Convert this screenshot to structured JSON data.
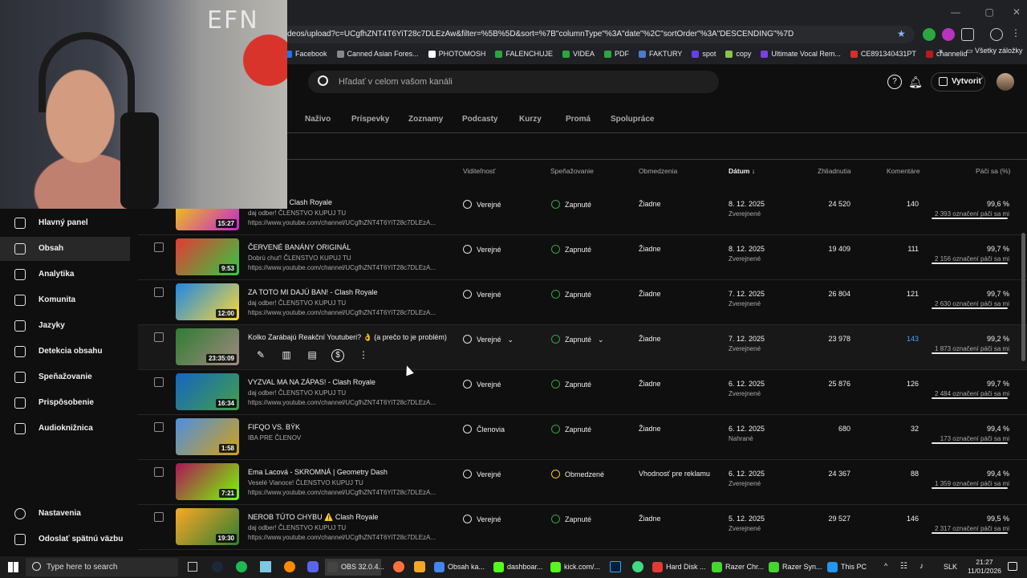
{
  "browser": {
    "url": "deos/upload?c=UCgfhZNT4T6YiT28c7DLEzAw&filter=%5B%5D&sort=%7B\"columnType\"%3A\"date\"%2C\"sortOrder\"%3A\"DESCENDING\"%7D",
    "bookmarks": [
      {
        "label": "Facebook",
        "color": "#1877f2"
      },
      {
        "label": "Canned Asian Fores...",
        "color": "#888"
      },
      {
        "label": "PHOTOMOSH",
        "color": "#fff"
      },
      {
        "label": "FALENCHUJE",
        "color": "#2ba640"
      },
      {
        "label": "VIDEA",
        "color": "#2ba640"
      },
      {
        "label": "PDF",
        "color": "#2ba640"
      },
      {
        "label": "FAKTURY",
        "color": "#4a7bd0"
      },
      {
        "label": "spot",
        "color": "#6a3de8"
      },
      {
        "label": "copy",
        "color": "#8bc34a"
      },
      {
        "label": "Ultimate Vocal Rem...",
        "color": "#7b3fe4"
      },
      {
        "label": "CE891340431PT",
        "color": "#d32f2f"
      },
      {
        "label": "channelid",
        "color": "#b71c1c"
      }
    ],
    "all_bookmarks": "Všetky záložky"
  },
  "header": {
    "search_placeholder": "Hľadať v celom vašom kanáli",
    "create_label": "Vytvoriť"
  },
  "tabs": [
    "Naživo",
    "Príspevky",
    "Zoznamy",
    "Podcasty",
    "Kurzy",
    "Promá",
    "Spolupráce"
  ],
  "columns": {
    "visibility": "Viditeľnosť",
    "monetization": "Speňažovanie",
    "restrictions": "Obmedzenia",
    "date": "Dátum",
    "views": "Zhliadnutia",
    "comments": "Komentáre",
    "likes": "Páči sa (%)"
  },
  "sidebar": [
    {
      "label": "Hlavný panel",
      "active": false
    },
    {
      "label": "Obsah",
      "active": true
    },
    {
      "label": "Analytika",
      "active": false
    },
    {
      "label": "Komunita",
      "active": false
    },
    {
      "label": "Jazyky",
      "active": false
    },
    {
      "label": "Detekcia obsahu",
      "active": false
    },
    {
      "label": "Speňažovanie",
      "active": false
    },
    {
      "label": "Prispôsobenie",
      "active": false
    },
    {
      "label": "Audioknižnica",
      "active": false
    }
  ],
  "sidebar_bottom": {
    "settings": "Nastavenia",
    "feedback": "Odoslať spätnú väzbu"
  },
  "videos": [
    {
      "title": "...KORD?? - Clash Royale",
      "desc": "daj odber! ČLENSTVO KUPUJ TU",
      "url": "https://www.youtube.com/channel/UCgfhZNT4T6YiT28c7DLEzA...",
      "duration": "15:27",
      "visibility": "Verejné",
      "monetization": "Zapnuté",
      "restrictions": "Žiadne",
      "date": "8. 12. 2025",
      "status": "Zverejnené",
      "views": "24 520",
      "comments": "140",
      "likes_pct": "99,6 %",
      "likes": "2 393 označení páči sa mi",
      "thumb": "linear-gradient(135deg,#f6d400,#c026d3)"
    },
    {
      "title": "ČERVENÉ BANÁNY ORIGINÁL",
      "desc": "Dobrú chuť! ČLENSTVO KUPUJ TU",
      "url": "https://www.youtube.com/channel/UCgfhZNT4T6YiT28c7DLEzA...",
      "duration": "9:53",
      "visibility": "Verejné",
      "monetization": "Zapnuté",
      "restrictions": "Žiadne",
      "date": "8. 12. 2025",
      "status": "Zverejnené",
      "views": "19 409",
      "comments": "111",
      "likes_pct": "99,7 %",
      "likes": "2 156 označení páči sa mi",
      "thumb": "linear-gradient(135deg,#e53935,#2ecc40)"
    },
    {
      "title": "ZA TOTO MI DAJÚ BAN! - Clash Royale",
      "desc": "daj odber! ČLENSTVO KUPUJ TU",
      "url": "https://www.youtube.com/channel/UCgfhZNT4T6YiT28c7DLEzA...",
      "duration": "12:00",
      "visibility": "Verejné",
      "monetization": "Zapnuté",
      "restrictions": "Žiadne",
      "date": "7. 12. 2025",
      "status": "Zverejnené",
      "views": "26 804",
      "comments": "121",
      "likes_pct": "99,7 %",
      "likes": "2 630 označení páči sa mi",
      "thumb": "linear-gradient(135deg,#1e88e5,#fdd835)"
    },
    {
      "title": "Kolko Zarábajú Reakční Youtuberi? 👌 (a prečo to je problém)",
      "desc": "",
      "url": "",
      "duration": "23:35:09",
      "visibility": "Verejné",
      "monetization": "Zapnuté",
      "restrictions": "Žiadne",
      "date": "7. 12. 2025",
      "status": "Zverejnené",
      "views": "23 978",
      "comments": "143",
      "likes_pct": "99,2 %",
      "likes": "1 873 označení páči sa mi",
      "thumb": "linear-gradient(135deg,#2e7d32,#a1887f)",
      "hover": true
    },
    {
      "title": "VYZVAL MA NA ZÁPAS! - Clash Royale",
      "desc": "daj odber! ČLENSTVO KUPUJ TU",
      "url": "https://www.youtube.com/channel/UCgfhZNT4T6YiT28c7DLEzA...",
      "duration": "16:34",
      "visibility": "Verejné",
      "monetization": "Zapnuté",
      "restrictions": "Žiadne",
      "date": "6. 12. 2025",
      "status": "Zverejnené",
      "views": "25 876",
      "comments": "126",
      "likes_pct": "99,7 %",
      "likes": "2 484 označení páči sa mi",
      "thumb": "linear-gradient(135deg,#1565c0,#43a047)"
    },
    {
      "title": "FIFQO VS. BÝK",
      "desc": "IBA PRE ČLENOV",
      "url": "",
      "duration": "1:58",
      "visibility": "Členovia",
      "monetization": "Zapnuté",
      "restrictions": "Žiadne",
      "date": "6. 12. 2025",
      "status": "Nahrané",
      "views": "680",
      "comments": "32",
      "likes_pct": "99,4 %",
      "likes": "173 označení páči sa mi",
      "thumb": "linear-gradient(135deg,#4a90e2,#d4a017)"
    },
    {
      "title": "Ema Lacová - SKROMNÁ | Geometry Dash",
      "desc": "Veselé Vianoce! ČLENSTVO KUPUJ TU",
      "url": "https://www.youtube.com/channel/UCgfhZNT4T6YiT28c7DLEzA...",
      "duration": "7:21",
      "visibility": "Verejné",
      "monetization": "Obmedzené",
      "restrictions": "Vhodnosť pre reklamu",
      "date": "6. 12. 2025",
      "status": "Zverejnené",
      "views": "24 367",
      "comments": "88",
      "likes_pct": "99,4 %",
      "likes": "1 359 označení páči sa mi",
      "thumb": "linear-gradient(135deg,#ad1457,#76ff03)"
    },
    {
      "title": "NEROB TÚTO CHYBU ⚠️ Clash Royale",
      "desc": "daj odber! ČLENSTVO KUPUJ TU",
      "url": "https://www.youtube.com/channel/UCgfhZNT4T6YiT28c7DLEzA...",
      "duration": "19:30",
      "visibility": "Verejné",
      "monetization": "Zapnuté",
      "restrictions": "Žiadne",
      "date": "5. 12. 2025",
      "status": "Zverejnené",
      "views": "29 527",
      "comments": "146",
      "likes_pct": "99,5 %",
      "likes": "2 317 označení páči sa mi",
      "thumb": "linear-gradient(135deg,#f9a825,#2e7d32)"
    }
  ],
  "webcam": {
    "wall_text": "EFN"
  },
  "taskbar": {
    "search": "Type here to search",
    "apps": [
      {
        "label": "OBS 32.0.4...",
        "color": "#444",
        "active": true
      },
      {
        "label": "Obsah ka...",
        "color": "#4285f4",
        "active": false
      },
      {
        "label": "dashboar...",
        "color": "#53fc18",
        "active": false
      },
      {
        "label": "kick.com/...",
        "color": "#53fc18",
        "active": false
      },
      {
        "label": "Hard Disk ...",
        "color": "#e53935",
        "active": false
      },
      {
        "label": "Razer Chr...",
        "color": "#44d62c",
        "active": false
      },
      {
        "label": "Razer Syn...",
        "color": "#44d62c",
        "active": false
      },
      {
        "label": "This PC",
        "color": "#2196f3",
        "active": false
      }
    ],
    "lang": "SLK",
    "time": "21:27",
    "date": "11/01/2026"
  }
}
